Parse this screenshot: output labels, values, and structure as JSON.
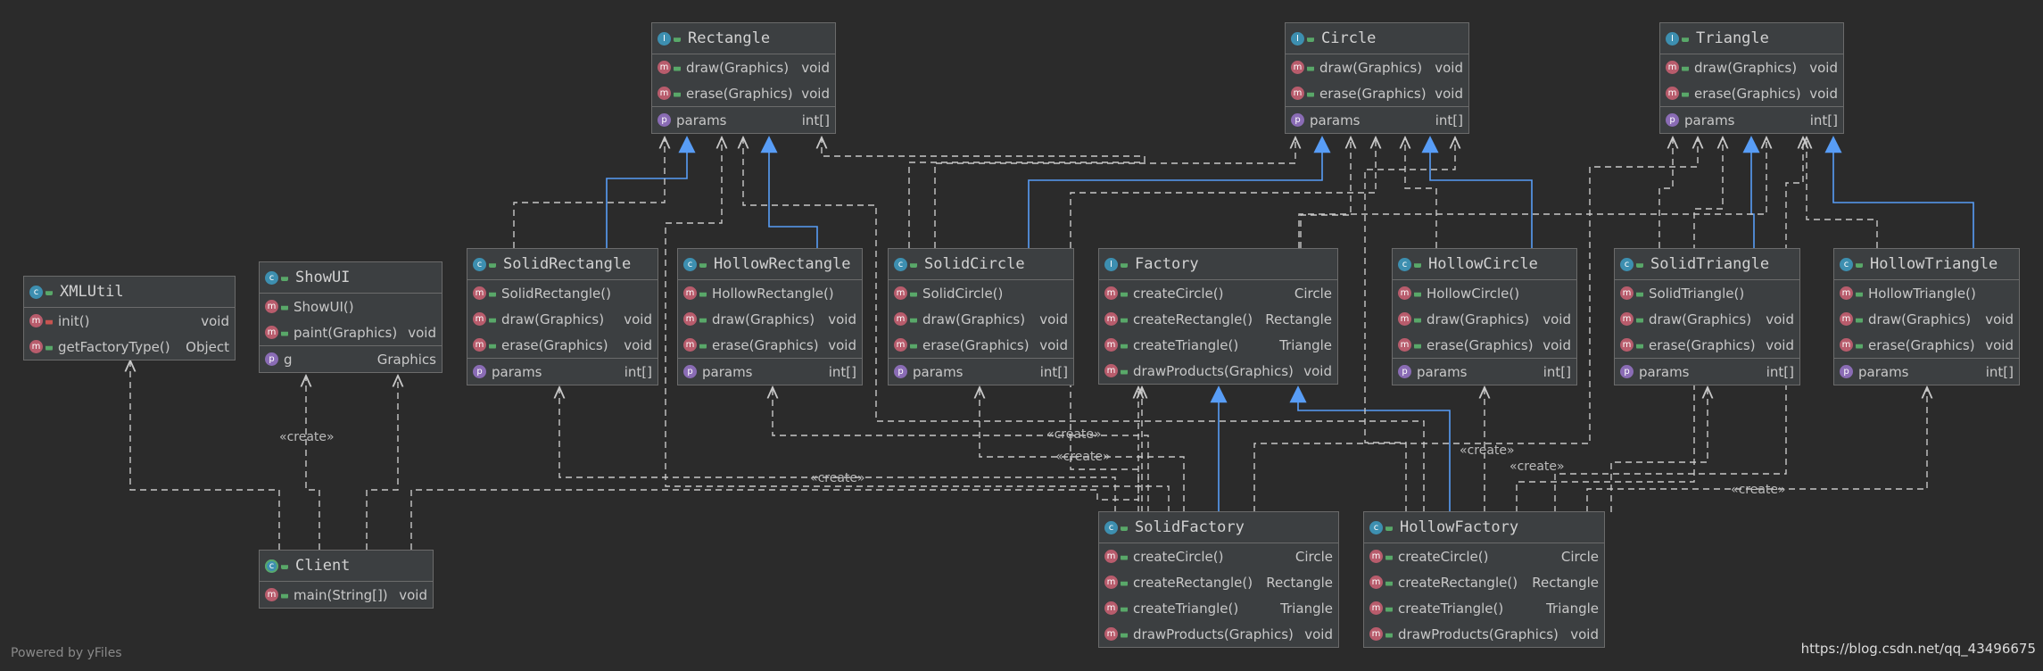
{
  "footer": {
    "powered_by": "Powered by yFiles",
    "watermark": "https://blog.csdn.net/qq_43496675"
  },
  "create_label": "«create»",
  "nodes": {
    "Rectangle": {
      "name": "Rectangle",
      "kind": "interface",
      "members": [
        {
          "icon": "method-abstract",
          "name": "draw(Graphics)",
          "type": "void"
        },
        {
          "icon": "method-abstract",
          "name": "erase(Graphics)",
          "type": "void"
        },
        {
          "icon": "property",
          "name": "params",
          "type": "int[]",
          "section": true
        }
      ]
    },
    "Circle": {
      "name": "Circle",
      "kind": "interface",
      "members": [
        {
          "icon": "method-abstract",
          "name": "draw(Graphics)",
          "type": "void"
        },
        {
          "icon": "method-abstract",
          "name": "erase(Graphics)",
          "type": "void"
        },
        {
          "icon": "property",
          "name": "params",
          "type": "int[]",
          "section": true
        }
      ]
    },
    "Triangle": {
      "name": "Triangle",
      "kind": "interface",
      "members": [
        {
          "icon": "method-abstract",
          "name": "draw(Graphics)",
          "type": "void"
        },
        {
          "icon": "method-abstract",
          "name": "erase(Graphics)",
          "type": "void"
        },
        {
          "icon": "property",
          "name": "params",
          "type": "int[]",
          "section": true
        }
      ]
    },
    "XMLUtil": {
      "name": "XMLUtil",
      "kind": "class",
      "members": [
        {
          "icon": "method",
          "vis": "private",
          "name": "init()",
          "type": "void"
        },
        {
          "icon": "method",
          "name": "getFactoryType()",
          "type": "Object"
        }
      ]
    },
    "ShowUI": {
      "name": "ShowUI",
      "kind": "class",
      "members": [
        {
          "icon": "method",
          "name": "ShowUI()",
          "type": ""
        },
        {
          "icon": "method",
          "name": "paint(Graphics)",
          "type": "void"
        },
        {
          "icon": "property",
          "name": "g",
          "type": "Graphics",
          "section": true
        }
      ]
    },
    "SolidRectangle": {
      "name": "SolidRectangle",
      "kind": "class",
      "members": [
        {
          "icon": "method",
          "name": "SolidRectangle()",
          "type": ""
        },
        {
          "icon": "method",
          "name": "draw(Graphics)",
          "type": "void"
        },
        {
          "icon": "method",
          "name": "erase(Graphics)",
          "type": "void"
        },
        {
          "icon": "property",
          "name": "params",
          "type": "int[]",
          "section": true
        }
      ]
    },
    "HollowRectangle": {
      "name": "HollowRectangle",
      "kind": "class",
      "members": [
        {
          "icon": "method",
          "name": "HollowRectangle()",
          "type": ""
        },
        {
          "icon": "method",
          "name": "draw(Graphics)",
          "type": "void"
        },
        {
          "icon": "method",
          "name": "erase(Graphics)",
          "type": "void"
        },
        {
          "icon": "property",
          "name": "params",
          "type": "int[]",
          "section": true
        }
      ]
    },
    "SolidCircle": {
      "name": "SolidCircle",
      "kind": "class",
      "members": [
        {
          "icon": "method",
          "name": "SolidCircle()",
          "type": ""
        },
        {
          "icon": "method",
          "name": "draw(Graphics)",
          "type": "void"
        },
        {
          "icon": "method",
          "name": "erase(Graphics)",
          "type": "void"
        },
        {
          "icon": "property",
          "name": "params",
          "type": "int[]",
          "section": true
        }
      ]
    },
    "Factory": {
      "name": "Factory",
      "kind": "interface",
      "members": [
        {
          "icon": "method-abstract",
          "name": "createCircle()",
          "type": "Circle"
        },
        {
          "icon": "method-abstract",
          "name": "createRectangle()",
          "type": "Rectangle"
        },
        {
          "icon": "method-abstract",
          "name": "createTriangle()",
          "type": "Triangle"
        },
        {
          "icon": "method-abstract",
          "name": "drawProducts(Graphics)",
          "type": "void"
        }
      ]
    },
    "HollowCircle": {
      "name": "HollowCircle",
      "kind": "class",
      "members": [
        {
          "icon": "method",
          "name": "HollowCircle()",
          "type": ""
        },
        {
          "icon": "method",
          "name": "draw(Graphics)",
          "type": "void"
        },
        {
          "icon": "method",
          "name": "erase(Graphics)",
          "type": "void"
        },
        {
          "icon": "property",
          "name": "params",
          "type": "int[]",
          "section": true
        }
      ]
    },
    "SolidTriangle": {
      "name": "SolidTriangle",
      "kind": "class",
      "members": [
        {
          "icon": "method",
          "name": "SolidTriangle()",
          "type": ""
        },
        {
          "icon": "method",
          "name": "draw(Graphics)",
          "type": "void"
        },
        {
          "icon": "method",
          "name": "erase(Graphics)",
          "type": "void"
        },
        {
          "icon": "property",
          "name": "params",
          "type": "int[]",
          "section": true
        }
      ]
    },
    "HollowTriangle": {
      "name": "HollowTriangle",
      "kind": "class",
      "members": [
        {
          "icon": "method",
          "name": "HollowTriangle()",
          "type": ""
        },
        {
          "icon": "method",
          "name": "draw(Graphics)",
          "type": "void"
        },
        {
          "icon": "method",
          "name": "erase(Graphics)",
          "type": "void"
        },
        {
          "icon": "property",
          "name": "params",
          "type": "int[]",
          "section": true
        }
      ]
    },
    "Client": {
      "name": "Client",
      "kind": "main",
      "members": [
        {
          "icon": "method-static",
          "name": "main(String[])",
          "type": "void"
        }
      ]
    },
    "SolidFactory": {
      "name": "SolidFactory",
      "kind": "class",
      "members": [
        {
          "icon": "method",
          "name": "createCircle()",
          "type": "Circle"
        },
        {
          "icon": "method",
          "name": "createRectangle()",
          "type": "Rectangle"
        },
        {
          "icon": "method",
          "name": "createTriangle()",
          "type": "Triangle"
        },
        {
          "icon": "method",
          "name": "drawProducts(Graphics)",
          "type": "void"
        }
      ]
    },
    "HollowFactory": {
      "name": "HollowFactory",
      "kind": "class",
      "members": [
        {
          "icon": "method",
          "name": "createCircle()",
          "type": "Circle"
        },
        {
          "icon": "method",
          "name": "createRectangle()",
          "type": "Rectangle"
        },
        {
          "icon": "method",
          "name": "createTriangle()",
          "type": "Triangle"
        },
        {
          "icon": "method",
          "name": "drawProducts(Graphics)",
          "type": "void"
        }
      ]
    }
  },
  "colors": {
    "realization": "#589df6",
    "dependency": "#c8c8c8",
    "background": "#2b2b2b"
  }
}
